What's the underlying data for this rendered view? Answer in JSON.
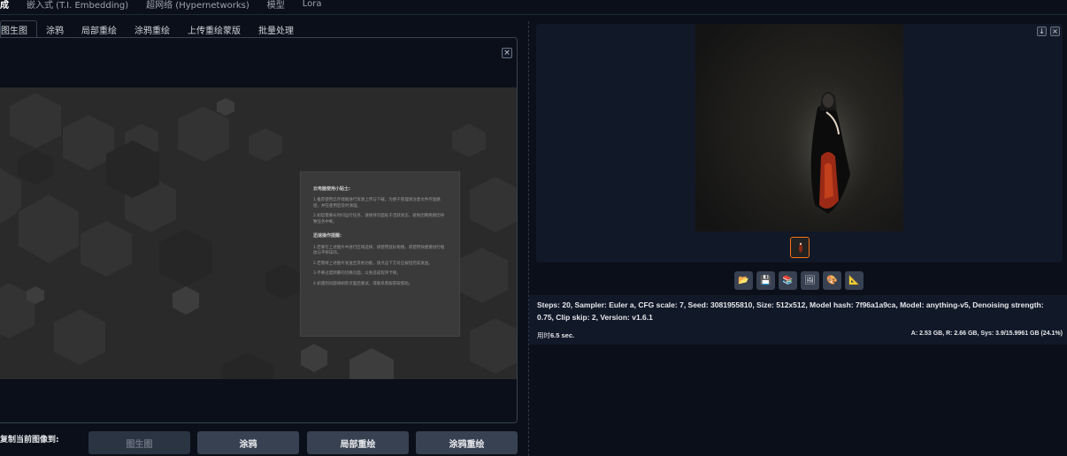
{
  "top_tabs": [
    "成",
    "嵌入式 (T.I. Embedding)",
    "超网络 (Hypernetworks)",
    "模型",
    "Lora"
  ],
  "sub_tabs": [
    "图生图",
    "涂鸦",
    "局部重绘",
    "涂鸦重绘",
    "上传重绘蒙版",
    "批量处理"
  ],
  "close_glyph": "×",
  "tips": {
    "heading1": "云电脑使用小贴士:",
    "p1": "1.推荐使用云存储端进行资源上传与下载，为便于管理请注意文件存放路径，并在使用后及时清理。",
    "p2": "2.如您需要长时间运行任务，请保持页面处于活跃状态，避免因网络原因导致任务中断。",
    "heading2": "迅速操作提醒:",
    "p3": "1.若要在上述图片中进行区域选择，请使用鼠标拖拽，或使用快捷键进行缩放与平移操作。",
    "p4": "2.若需将上述图片发送至其他功能，请点击下方对应按钮完成发送。",
    "p5": "3.不要过度频繁的切换页面，以免造成程序卡顿。",
    "p6": "4.如遇到问题请刷新页面后重试，或联系客服获取帮助。"
  },
  "copy_label": "复制当前图像到:",
  "actions": [
    "图生图",
    "涂鸦",
    "局部重绘",
    "涂鸦重绘"
  ],
  "gallery_buttons": {
    "download": "↓",
    "close": "×"
  },
  "tool_icons": [
    "📂",
    "💾",
    "📚",
    "🖼",
    "🎨",
    "📐"
  ],
  "info_text": "Steps: 20, Sampler: Euler a, CFG scale: 7, Seed: 3081955810, Size: 512x512, Model hash: 7f96a1a9ca, Model: anything-v5, Denoising strength: 0.75, Clip skip: 2, Version: v1.6.1",
  "time": {
    "label": "用时",
    "value": "6.5 sec."
  },
  "memory": "A: 2.53 GB, R: 2.66 GB, Sys: 3.9/15.9961 GB (24.1%)"
}
